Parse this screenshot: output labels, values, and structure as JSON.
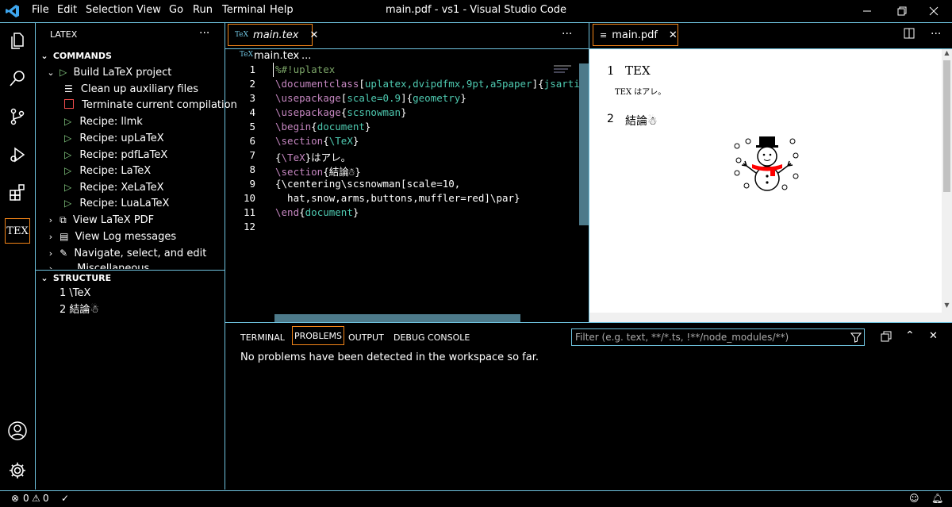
{
  "window": {
    "title": "main.pdf - vs1 - Visual Studio Code",
    "menu": [
      "File",
      "Edit",
      "Selection",
      "View",
      "Go",
      "Run",
      "Terminal",
      "Help"
    ]
  },
  "sidebar": {
    "view_title": "LATEX",
    "commands_header": "COMMANDS",
    "build_label": "Build LaTeX project",
    "build_children": [
      "Clean up auxiliary files",
      "Terminate current compilation",
      "Recipe: llmk",
      "Recipe: upLaTeX",
      "Recipe: pdfLaTeX",
      "Recipe: LaTeX",
      "Recipe: XeLaTeX",
      "Recipe: LuaLaTeX"
    ],
    "view_pdf": "View LaTeX PDF",
    "view_log": "View Log messages",
    "navigate": "Navigate, select, and edit",
    "misc": "Miscellaneous",
    "structure_header": "STRUCTURE",
    "structure_items": [
      "1 \\TeX",
      "2 結論☃"
    ],
    "tex_badge": "TEX"
  },
  "editor": {
    "tab_label": "main.tex",
    "breadcrumb_file": "main.tex",
    "breadcrumb_rest": "...",
    "line_numbers": [
      "1",
      "2",
      "3",
      "4",
      "5",
      "6",
      "7",
      "8",
      "9",
      "10",
      "11",
      "12"
    ]
  },
  "pdf": {
    "tab_label": "main.pdf",
    "sec1_num": "1",
    "sec1_title": "TEX",
    "body_text": "TEX はアレ。",
    "sec2_num": "2",
    "sec2_title": "結論☃"
  },
  "panel": {
    "tabs": [
      "TERMINAL",
      "PROBLEMS",
      "OUTPUT",
      "DEBUG CONSOLE"
    ],
    "active_tab": "PROBLEMS",
    "filter_placeholder": "Filter (e.g. text, **/*.ts, !**/node_modules/**)",
    "message": "No problems have been detected in the workspace so far."
  },
  "status": {
    "errors": "0",
    "warnings": "0"
  },
  "colors": {
    "accent_border": "#6fc3df",
    "active_orange": "#f38518",
    "keyword": "#c586c0",
    "argument": "#4ec9b0",
    "comment": "#7ca668"
  }
}
